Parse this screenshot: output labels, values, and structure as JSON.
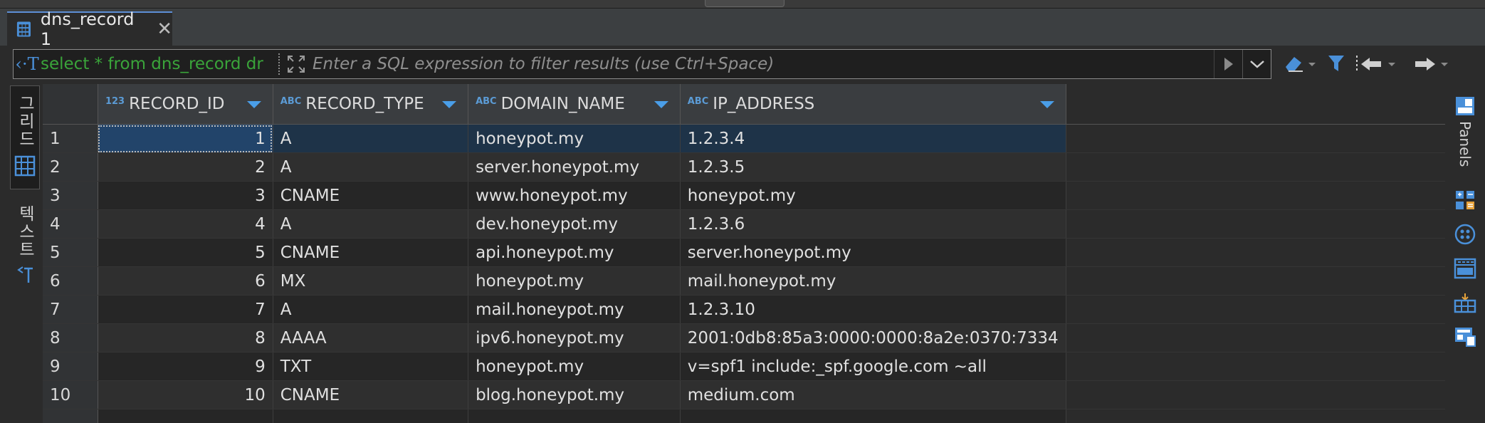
{
  "tab": {
    "title": "dns_record 1",
    "close": "✕"
  },
  "filter": {
    "sql_query": "select * from dns_record dr",
    "placeholder": "Enter a SQL expression to filter results (use Ctrl+Space)",
    "sql_icon": "‹·T"
  },
  "left_tabs": {
    "grid_label": "그리드",
    "text_label": "텍스트"
  },
  "right_panel": {
    "panels_label": "Panels"
  },
  "columns": [
    {
      "name": "RECORD_ID",
      "type_badge": "123"
    },
    {
      "name": "RECORD_TYPE",
      "type_badge": "ABC"
    },
    {
      "name": "DOMAIN_NAME",
      "type_badge": "ABC"
    },
    {
      "name": "IP_ADDRESS",
      "type_badge": "ABC"
    }
  ],
  "rows": [
    {
      "n": "1",
      "id": "1",
      "type": "A",
      "domain": "honeypot.my",
      "ip": "1.2.3.4"
    },
    {
      "n": "2",
      "id": "2",
      "type": "A",
      "domain": "server.honeypot.my",
      "ip": "1.2.3.5"
    },
    {
      "n": "3",
      "id": "3",
      "type": "CNAME",
      "domain": "www.honeypot.my",
      "ip": "honeypot.my"
    },
    {
      "n": "4",
      "id": "4",
      "type": "A",
      "domain": "dev.honeypot.my",
      "ip": "1.2.3.6"
    },
    {
      "n": "5",
      "id": "5",
      "type": "CNAME",
      "domain": "api.honeypot.my",
      "ip": "server.honeypot.my"
    },
    {
      "n": "6",
      "id": "6",
      "type": "MX",
      "domain": "honeypot.my",
      "ip": "mail.honeypot.my"
    },
    {
      "n": "7",
      "id": "7",
      "type": "A",
      "domain": "mail.honeypot.my",
      "ip": "1.2.3.10"
    },
    {
      "n": "8",
      "id": "8",
      "type": "AAAA",
      "domain": "ipv6.honeypot.my",
      "ip": "2001:0db8:85a3:0000:0000:8a2e:0370:7334"
    },
    {
      "n": "9",
      "id": "9",
      "type": "TXT",
      "domain": "honeypot.my",
      "ip": "v=spf1 include:_spf.google.com ~all"
    },
    {
      "n": "10",
      "id": "10",
      "type": "CNAME",
      "domain": "blog.honeypot.my",
      "ip": "medium.com"
    }
  ],
  "colors": {
    "accent": "#4a9ee8",
    "sql_green": "#3aa43a",
    "selected_row": "#1e3348"
  }
}
